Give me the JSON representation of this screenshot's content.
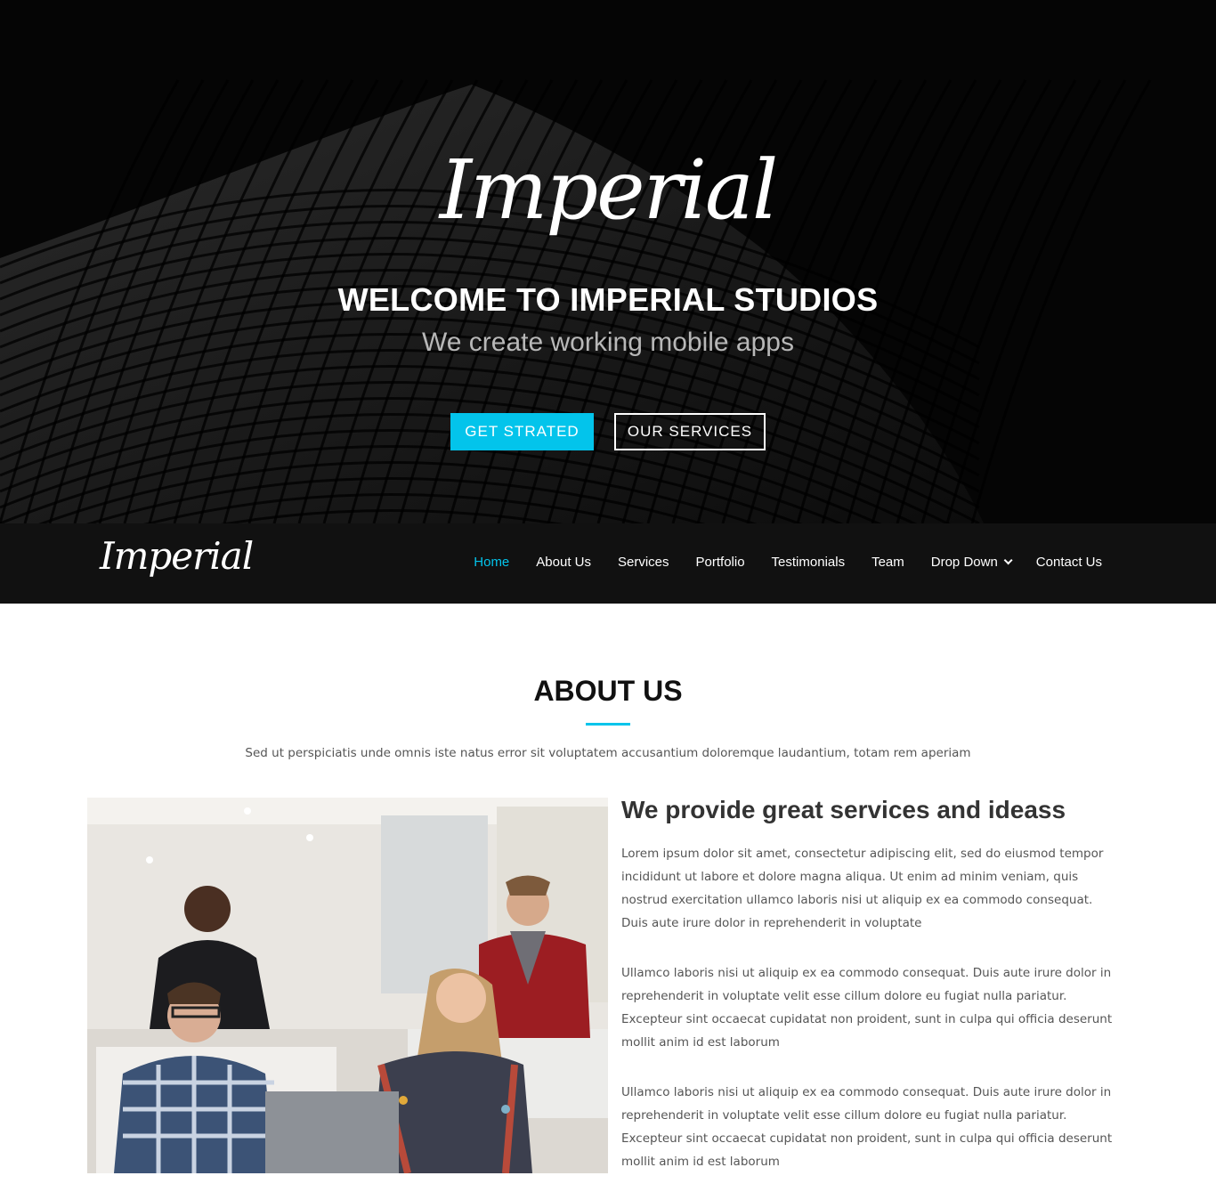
{
  "hero": {
    "logo": "Imperial",
    "title": "WELCOME TO IMPERIAL STUDIOS",
    "subtitle": "We create working mobile apps",
    "primary_button": "GET STRATED",
    "secondary_button": "OUR SERVICES"
  },
  "nav": {
    "logo": "Imperial",
    "items": [
      {
        "label": "Home",
        "active": true
      },
      {
        "label": "About Us"
      },
      {
        "label": "Services"
      },
      {
        "label": "Portfolio"
      },
      {
        "label": "Testimonials"
      },
      {
        "label": "Team"
      },
      {
        "label": "Drop Down",
        "dropdown": true
      },
      {
        "label": "Contact Us"
      }
    ]
  },
  "about": {
    "title": "ABOUT US",
    "lead": "Sed ut perspiciatis unde omnis iste natus error sit voluptatem accusantium doloremque laudantium, totam rem aperiam",
    "heading": "We provide great services and ideass",
    "paragraphs": [
      "Lorem ipsum dolor sit amet, consectetur adipiscing elit, sed do eiusmod tempor incididunt ut labore et dolore magna aliqua. Ut enim ad minim veniam, quis nostrud exercitation ullamco laboris nisi ut aliquip ex ea commodo consequat. Duis aute irure dolor in reprehenderit in voluptate",
      "Ullamco laboris nisi ut aliquip ex ea commodo consequat. Duis aute irure dolor in reprehenderit in voluptate velit esse cillum dolore eu fugiat nulla pariatur. Excepteur sint occaecat cupidatat non proident, sunt in culpa qui officia deserunt mollit anim id est laborum",
      "Ullamco laboris nisi ut aliquip ex ea commodo consequat. Duis aute irure dolor in reprehenderit in voluptate velit esse cillum dolore eu fugiat nulla pariatur. Excepteur sint occaecat cupidatat non proident, sunt in culpa qui officia deserunt mollit anim id est laborum"
    ],
    "image_alt": "team-meeting-photo"
  },
  "colors": {
    "accent": "#03c4eb",
    "nav_bg": "#111111"
  }
}
